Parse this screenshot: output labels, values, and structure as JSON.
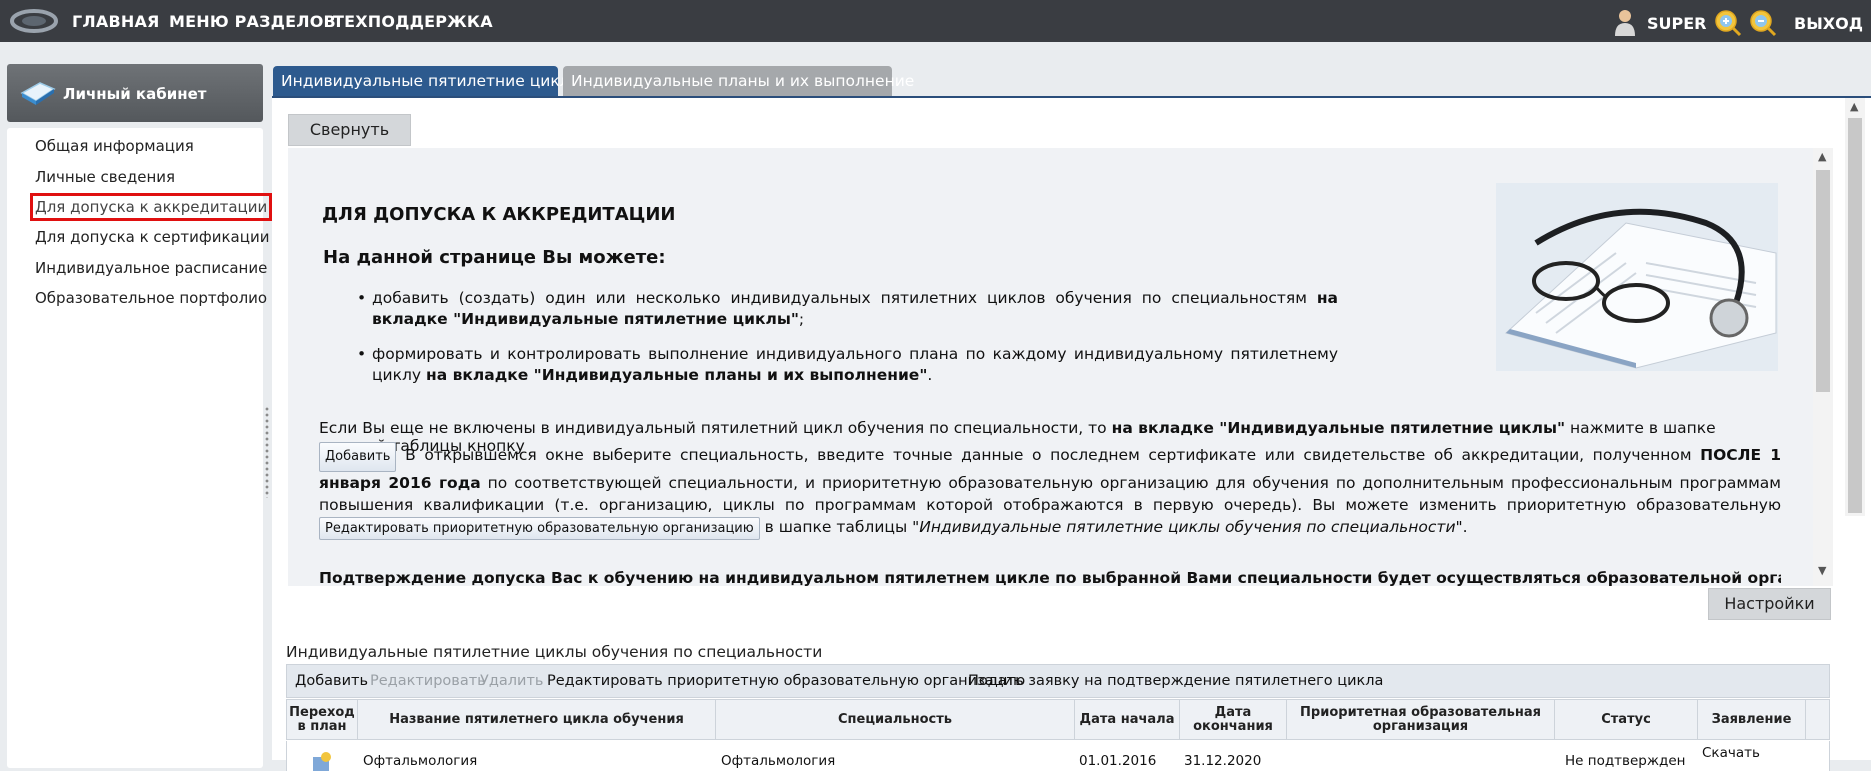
{
  "topbar": {
    "nav": [
      "ГЛАВНАЯ",
      "МЕНЮ РАЗДЕЛОВ",
      "ТЕХПОДДЕРЖКА"
    ],
    "user": "SUPER",
    "logout": "ВЫХОД"
  },
  "sidebar": {
    "title": "Личный кабинет",
    "items": [
      {
        "label": "Общая информация"
      },
      {
        "label": "Личные сведения"
      },
      {
        "label": "Для допуска к аккредитации"
      },
      {
        "label": "Для допуска к сертификации"
      },
      {
        "label": "Индивидуальное расписание"
      },
      {
        "label": "Образовательное портфолио"
      }
    ]
  },
  "tabs": [
    "Индивидуальные пятилетние циклы",
    "Индивидуальные планы и их выполнение"
  ],
  "content": {
    "collapse_label": "Свернуть",
    "heading": "ДЛЯ ДОПУСКА К АККРЕДИТАЦИИ",
    "subheading": "На данной странице Вы можете:",
    "bullet1_text": "добавить (создать) один или несколько индивидуальных пятилетних циклов обучения по специальностям ",
    "bullet1_bold": "на вкладке \"Индивидуальные пятилетние циклы\"",
    "bullet1_end": ";",
    "bullet2_text": "формировать и контролировать выполнение индивидуального плана по каждому индивидуальному пятилетнему циклу ",
    "bullet2_bold": "на вкладке \"Индивидуальные планы и их выполнение\"",
    "bullet2_end": ".",
    "p1_a": "Если Вы еще не включены в индивидуальный пятилетний цикл обучения по специальности, то ",
    "p1_b": "на вкладке \"Индивидуальные пятилетние циклы\"",
    "p1_c": " нажмите в шапке верхней таблицы кнопку",
    "add_btn": "Добавить",
    "p2_a": " В открывшемся окне выберите специальность, введите точные данные о последнем сертификате или свидетельстве об аккредитации, полученном ",
    "p2_b": "ПОСЛЕ 1 января 2016 года",
    "p2_c": " по соответствующей специальности, и приоритетную образовательную организацию для обучения по дополнительным профессиональным программам повышения квалификации (т.е. организацию, циклы по программам которой отображаются в первую очередь). Вы можете изменить приоритетную образовательную организацию, нажав кнопку",
    "edit_btn": "Редактировать приоритетную образовательную организацию",
    "p3_a": " в шапке таблицы ",
    "p3_b": "\"Индивидуальные пятилетние циклы обучения по специальности\"",
    "p3_c": ".",
    "p4": "Подтверждение допуска Вас к обучению на индивидуальном пятилетнем цикле по выбранной Вами специальности будет осуществляться образовательной организацией, в"
  },
  "settings_label": "Настройки",
  "table": {
    "title": "Индивидуальные пятилетние циклы обучения по специальности",
    "toolbar": [
      {
        "label": "Добавить",
        "enabled": true
      },
      {
        "label": "Редактировать",
        "enabled": false
      },
      {
        "label": "Удалить",
        "enabled": false
      },
      {
        "label": "Редактировать приоритетную образовательную организацию",
        "enabled": true
      },
      {
        "label": "Подать заявку на подтверждение пятилетнего цикла",
        "enabled": true
      }
    ],
    "columns": [
      "Переход в план",
      "Название пятилетнего цикла обучения",
      "Специальность",
      "Дата начала",
      "Дата окончания",
      "Приоритетная образовательная организация",
      "Статус",
      "Заявление"
    ],
    "row": {
      "name": "Офтальмология",
      "specialty": "Офтальмология",
      "start": "01.01.2016",
      "end": "31.12.2020",
      "status": "Не подтвержден",
      "action": "Скачать"
    }
  }
}
